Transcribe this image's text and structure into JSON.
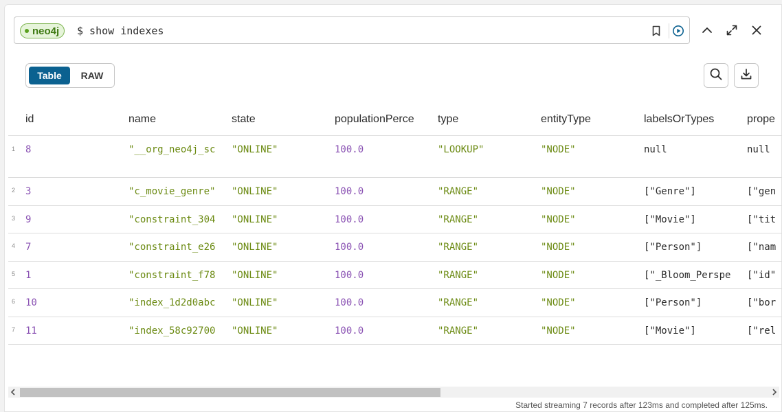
{
  "editor": {
    "db_name": "neo4j",
    "query": "$ show indexes"
  },
  "view_toggle": {
    "table_label": "Table",
    "raw_label": "RAW"
  },
  "table": {
    "columns": [
      "id",
      "name",
      "state",
      "populationPerce",
      "type",
      "entityType",
      "labelsOrTypes",
      "prope"
    ],
    "rows": [
      {
        "n": "1",
        "id": "8",
        "name": "\"__org_neo4j_sc",
        "state": "\"ONLINE\"",
        "pop": "100.0",
        "type": "\"LOOKUP\"",
        "entityType": "\"NODE\"",
        "labels": "null",
        "props": "null"
      },
      {
        "n": "2",
        "id": "3",
        "name": "\"c_movie_genre\"",
        "state": "\"ONLINE\"",
        "pop": "100.0",
        "type": "\"RANGE\"",
        "entityType": "\"NODE\"",
        "labels": "[\"Genre\"]",
        "props": "[\"gen"
      },
      {
        "n": "3",
        "id": "9",
        "name": "\"constraint_304",
        "state": "\"ONLINE\"",
        "pop": "100.0",
        "type": "\"RANGE\"",
        "entityType": "\"NODE\"",
        "labels": "[\"Movie\"]",
        "props": "[\"tit"
      },
      {
        "n": "4",
        "id": "7",
        "name": "\"constraint_e26",
        "state": "\"ONLINE\"",
        "pop": "100.0",
        "type": "\"RANGE\"",
        "entityType": "\"NODE\"",
        "labels": "[\"Person\"]",
        "props": "[\"nam"
      },
      {
        "n": "5",
        "id": "1",
        "name": "\"constraint_f78",
        "state": "\"ONLINE\"",
        "pop": "100.0",
        "type": "\"RANGE\"",
        "entityType": "\"NODE\"",
        "labels": "[\"_Bloom_Perspe",
        "props": "[\"id\""
      },
      {
        "n": "6",
        "id": "10",
        "name": "\"index_1d2d0abc",
        "state": "\"ONLINE\"",
        "pop": "100.0",
        "type": "\"RANGE\"",
        "entityType": "\"NODE\"",
        "labels": "[\"Person\"]",
        "props": "[\"bor"
      },
      {
        "n": "7",
        "id": "11",
        "name": "\"index_58c92700",
        "state": "\"ONLINE\"",
        "pop": "100.0",
        "type": "\"RANGE\"",
        "entityType": "\"NODE\"",
        "labels": "[\"Movie\"]",
        "props": "[\"rel"
      }
    ]
  },
  "status_text": "Started streaming 7 records after 123ms and completed after 125ms.",
  "colors": {
    "accent": "#0b6190",
    "db_pill_text": "#3e7a12",
    "number": "#8a52b3",
    "string": "#6b8a12"
  },
  "icons": [
    "bookmark-icon",
    "run-icon",
    "collapse-icon",
    "expand-icon",
    "close-icon",
    "search-icon",
    "download-icon",
    "scroll-left-icon",
    "scroll-right-icon"
  ]
}
